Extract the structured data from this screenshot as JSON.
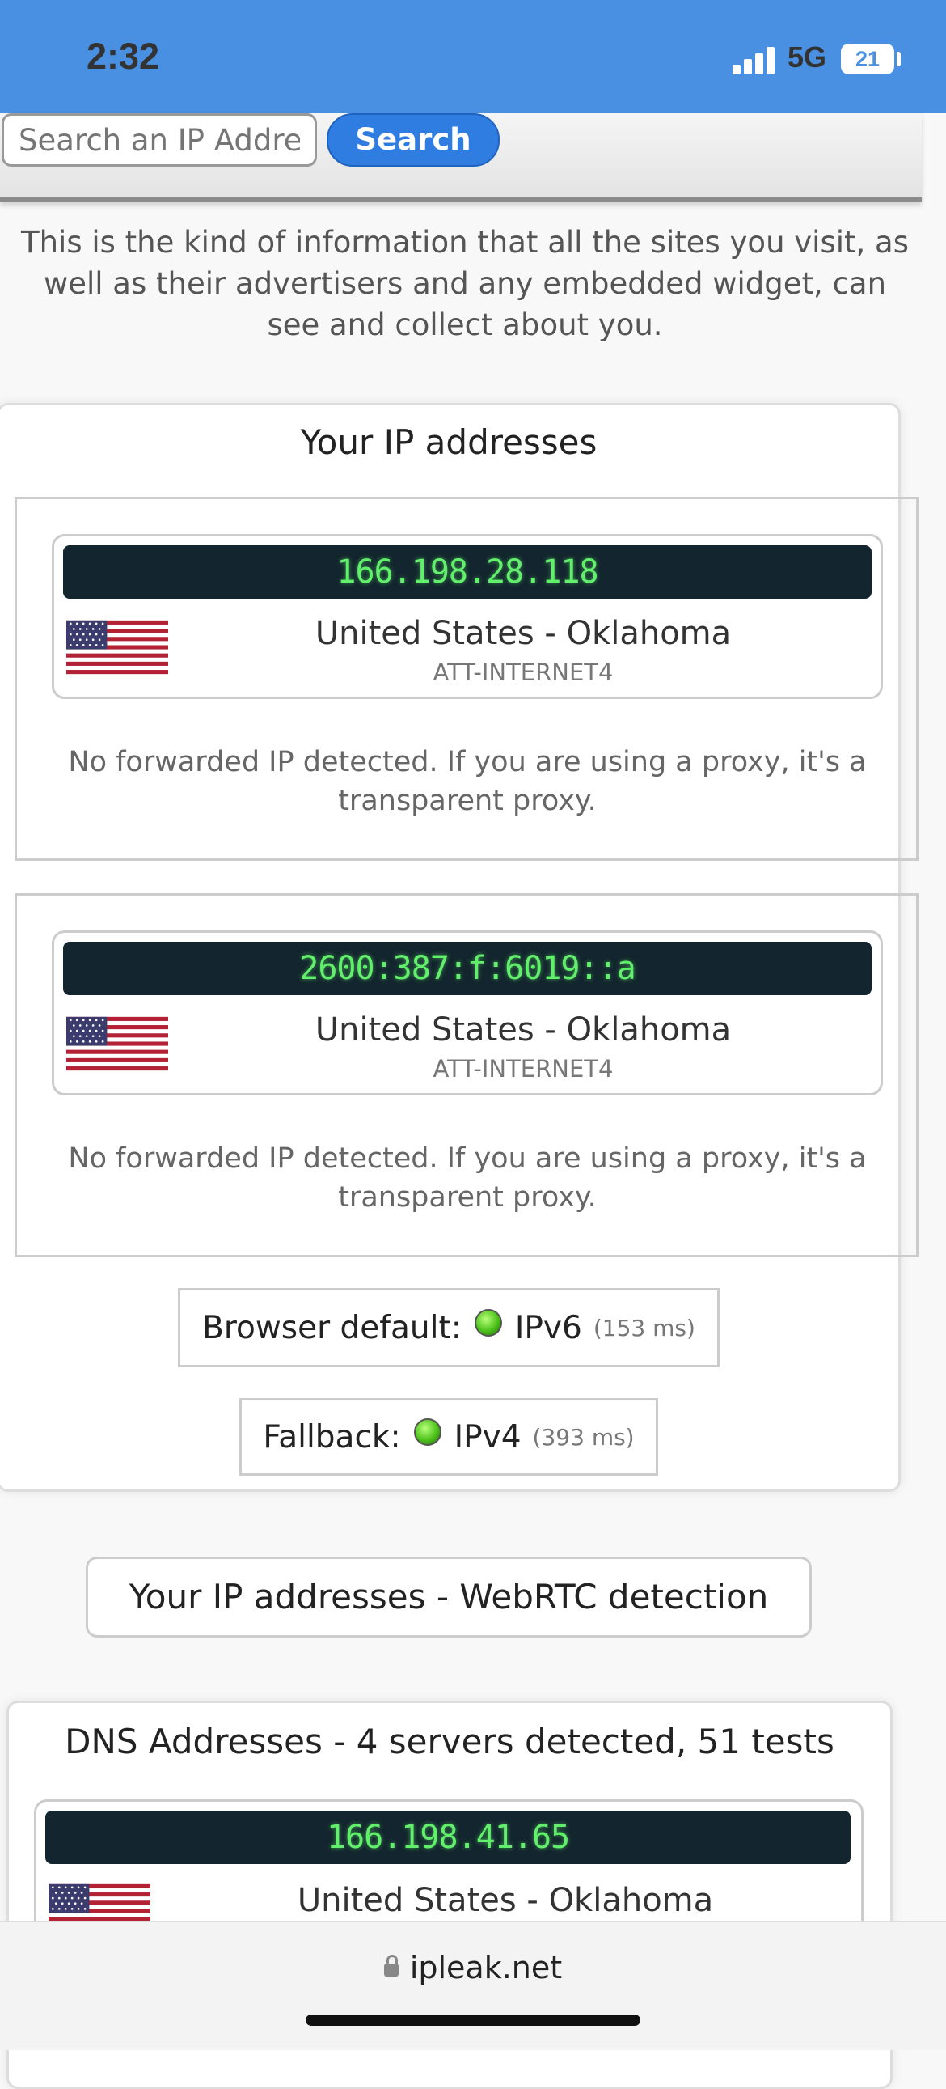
{
  "status_bar": {
    "time": "2:32",
    "network": "5G",
    "battery": "21"
  },
  "search": {
    "placeholder": "Search an IP Addre",
    "button_label": "Search"
  },
  "intro_text": "This is the kind of information that all the sites you visit, as well as their advertisers and any embedded widget, can see and collect about you.",
  "ip_section": {
    "title": "Your IP addresses",
    "entries": [
      {
        "ip": "166.198.28.118",
        "location": "United States - Oklahoma",
        "isp": "ATT-INTERNET4",
        "flag_icon": "us-flag-icon",
        "note": "No forwarded IP detected. If you are using a proxy, it's a transparent proxy."
      },
      {
        "ip": "2600:387:f:6019::a",
        "location": "United States - Oklahoma",
        "isp": "ATT-INTERNET4",
        "flag_icon": "us-flag-icon",
        "note": "No forwarded IP detected. If you are using a proxy, it's a transparent proxy."
      }
    ],
    "browser_default": {
      "label": "Browser default:",
      "protocol": "IPv6",
      "latency": "(153 ms)"
    },
    "fallback": {
      "label": "Fallback:",
      "protocol": "IPv4",
      "latency": "(393 ms)"
    }
  },
  "webrtc_button": "Your IP addresses - WebRTC detection",
  "dns_section": {
    "title": "DNS Addresses - 4 servers detected, 51 tests",
    "entries": [
      {
        "ip": "166.198.41.65",
        "location": "United States - Oklahoma",
        "flag_icon": "us-flag-icon"
      }
    ]
  },
  "browser": {
    "url": "ipleak.net"
  },
  "colors": {
    "status_bar": "#4a90e2",
    "search_button": "#2f7de1",
    "ip_bar_bg": "#13252e",
    "ip_text": "#62f06c",
    "status_dot": "#4cc21a"
  }
}
